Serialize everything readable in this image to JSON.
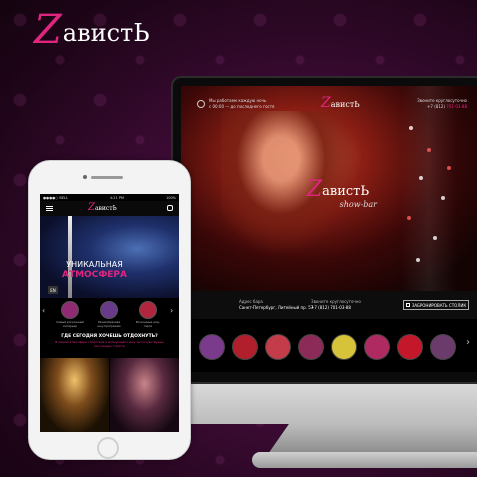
{
  "brand": {
    "z": "Z",
    "rest": "авистЬ"
  },
  "colors": {
    "accent": "#e0257f",
    "bg": "#3e0b36"
  },
  "desktop": {
    "topbar": {
      "hours_line1": "Мы работаем каждую ночь",
      "hours_line2": "с 00:00 — до последнего гостя",
      "logo_z": "Z",
      "logo_rest": "авистЬ",
      "logo_sub": "show-bar",
      "phone_label": "Звоните круглосуточно",
      "phone_prefix": "+7 (812)",
      "phone_number": "701-03-88"
    },
    "hero": {
      "logo_z": "Z",
      "logo_rest": "авистЬ",
      "logo_sub": "show-bar"
    },
    "info": {
      "address_label": "Адрес бара",
      "address_value": "Санкт-Петербург, Литейный пр. 57",
      "phone_label": "Звоните круглосуточно",
      "phone_value": "+7 (812) 701-03-88",
      "book_label": "ЗАБРОНИРОВАТЬ СТОЛИК",
      "book_icon": "table-icon"
    },
    "carousel": {
      "prev": "‹",
      "next": "›",
      "thumb_colors": [
        "#7a3b8c",
        "#b01f2b",
        "#c43c4a",
        "#8d2b58",
        "#d7c33a",
        "#b02a62",
        "#c5172a",
        "#6b3c6b"
      ]
    }
  },
  "mobile": {
    "status": {
      "carrier": "●●●●○ BELL",
      "time": "4:21 PM",
      "battery": "100%"
    },
    "nav": {
      "menu_icon": "hamburger-icon",
      "logo_z": "Z",
      "logo_rest": "авистЬ",
      "phone_icon": "phone-icon"
    },
    "banner": {
      "line1": "УНИКАЛЬНАЯ",
      "line2": "АТМОСФЕРА",
      "lang": "EN"
    },
    "features": [
      {
        "label": "Самый роскошный интерьер",
        "color": "#8f2a73"
      },
      {
        "label": "Разнообразная шоу-программа",
        "color": "#6a3a8a"
      },
      {
        "label": "Роскошные шоу-герлз",
        "color": "#b0263e"
      }
    ],
    "question": {
      "title": "ГДЕ СЕГОДНЯ ХОЧЕШЬ ОТДОХНУТЬ?",
      "desc": "В нашей атмосфере стриптиза и волнующего шоу ты почувствуешь настоящую страсть"
    },
    "arrows": {
      "prev": "‹",
      "next": "›"
    }
  }
}
